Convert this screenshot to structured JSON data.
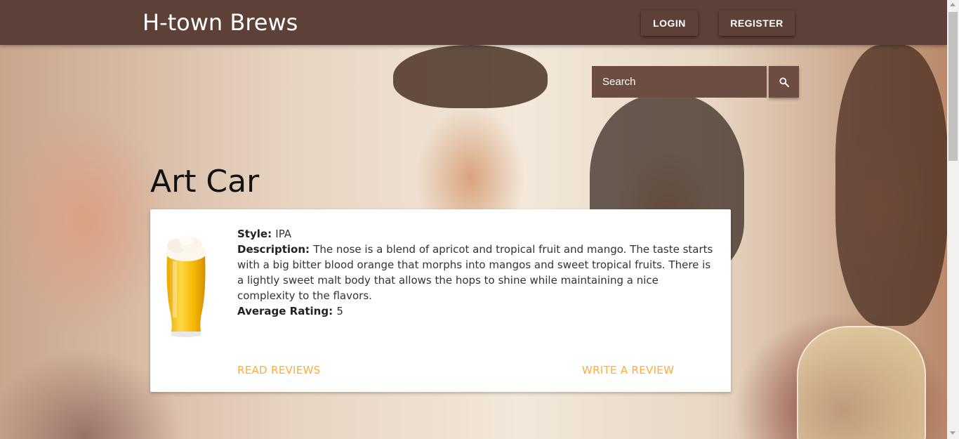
{
  "navbar": {
    "brand": "H-town Brews",
    "login_label": "LOGIN",
    "register_label": "REGISTER"
  },
  "search": {
    "placeholder": "Search",
    "icon": "search-icon"
  },
  "beer": {
    "name": "Art Car",
    "style_label": "Style:",
    "style": "IPA",
    "description_label": "Description:",
    "description": "The nose is a blend of apricot and tropical fruit and mango. The taste starts with a big bitter blood orange that morphs into mangos and sweet tropical fruits. There is a lightly sweet malt body that allows the hops to shine while maintaining a nice complexity to the flavors.",
    "rating_label": "Average Rating:",
    "rating": "5",
    "image_icon": "beer-glass-icon"
  },
  "actions": {
    "read_reviews": "READ REVIEWS",
    "write_review": "WRITE A REVIEW"
  },
  "colors": {
    "navbar": "#5d4037",
    "search": "#6d4c41",
    "accent": "#ffab40"
  }
}
